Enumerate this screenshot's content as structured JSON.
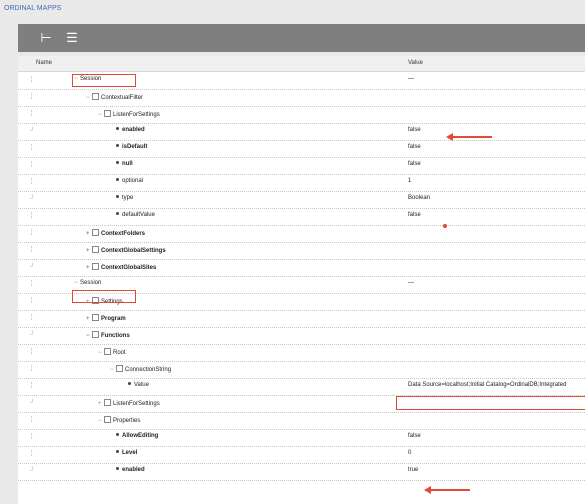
{
  "app": {
    "title": "ORDINAL MAPPS"
  },
  "toolbar": {
    "buttons": [
      {
        "icon": "tree-view-icon",
        "glyph": "⊢"
      },
      {
        "icon": "list-view-icon",
        "glyph": "☰"
      }
    ]
  },
  "columns": {
    "name": "Name",
    "value": "Value"
  },
  "rows": [
    {
      "indent": 0,
      "toggle": "−",
      "type": "group",
      "name": "Session",
      "value": "—",
      "bold": false
    },
    {
      "indent": 1,
      "toggle": "−",
      "type": "sq",
      "name": "ContextualFilter",
      "value": "",
      "bold": false
    },
    {
      "indent": 2,
      "toggle": "−",
      "type": "sq",
      "name": "ListenForSettings",
      "value": "",
      "bold": false
    },
    {
      "indent": 3,
      "toggle": "",
      "type": "dot",
      "name": "enabled",
      "value": "false",
      "bold": true
    },
    {
      "indent": 3,
      "toggle": "",
      "type": "dot",
      "name": "isDefault",
      "value": "false",
      "bold": true
    },
    {
      "indent": 3,
      "toggle": "",
      "type": "dot",
      "name": "null",
      "value": "false",
      "bold": true
    },
    {
      "indent": 3,
      "toggle": "",
      "type": "dot",
      "name": "optional",
      "value": "1",
      "bold": false
    },
    {
      "indent": 3,
      "toggle": "",
      "type": "dot",
      "name": "type",
      "value": "Boolean",
      "bold": false
    },
    {
      "indent": 3,
      "toggle": "",
      "type": "dot",
      "name": "defaultValue",
      "value": "false",
      "bold": false
    },
    {
      "indent": 1,
      "toggle": "+",
      "type": "sq",
      "name": "ContextFolders",
      "value": "",
      "bold": true
    },
    {
      "indent": 1,
      "toggle": "+",
      "type": "sq",
      "name": "ContextGlobalSettings",
      "value": "",
      "bold": true
    },
    {
      "indent": 1,
      "toggle": "+",
      "type": "sq",
      "name": "ContextGlobalSites",
      "value": "",
      "bold": true
    },
    {
      "indent": 0,
      "toggle": "−",
      "type": "group",
      "name": "Session",
      "value": "—",
      "bold": false
    },
    {
      "indent": 1,
      "toggle": "+",
      "type": "sq",
      "name": "Settings",
      "value": "",
      "bold": false
    },
    {
      "indent": 1,
      "toggle": "+",
      "type": "sq",
      "name": "Program",
      "value": "",
      "bold": true
    },
    {
      "indent": 1,
      "toggle": "−",
      "type": "sq",
      "name": "Functions",
      "value": "",
      "bold": true
    },
    {
      "indent": 2,
      "toggle": "−",
      "type": "sq",
      "name": "Root",
      "value": "",
      "bold": false
    },
    {
      "indent": 3,
      "toggle": "−",
      "type": "sq",
      "name": "ConnectionString",
      "value": "",
      "bold": false
    },
    {
      "indent": 4,
      "toggle": "",
      "type": "dot",
      "name": "Value",
      "value": "Data Source=localhost;Initial Catalog=OrdinalDB;Integrated",
      "bold": false
    },
    {
      "indent": 2,
      "toggle": "+",
      "type": "sq",
      "name": "ListenForSettings",
      "value": "",
      "bold": false
    },
    {
      "indent": 2,
      "toggle": "−",
      "type": "sq",
      "name": "Properties",
      "value": "",
      "bold": false
    },
    {
      "indent": 3,
      "toggle": "",
      "type": "dot",
      "name": "AllowEditing",
      "value": "false",
      "bold": true
    },
    {
      "indent": 3,
      "toggle": "",
      "type": "dot",
      "name": "Level",
      "value": "0",
      "bold": true
    },
    {
      "indent": 3,
      "toggle": "",
      "type": "dot",
      "name": "enabled",
      "value": "true",
      "bold": true
    }
  ]
}
